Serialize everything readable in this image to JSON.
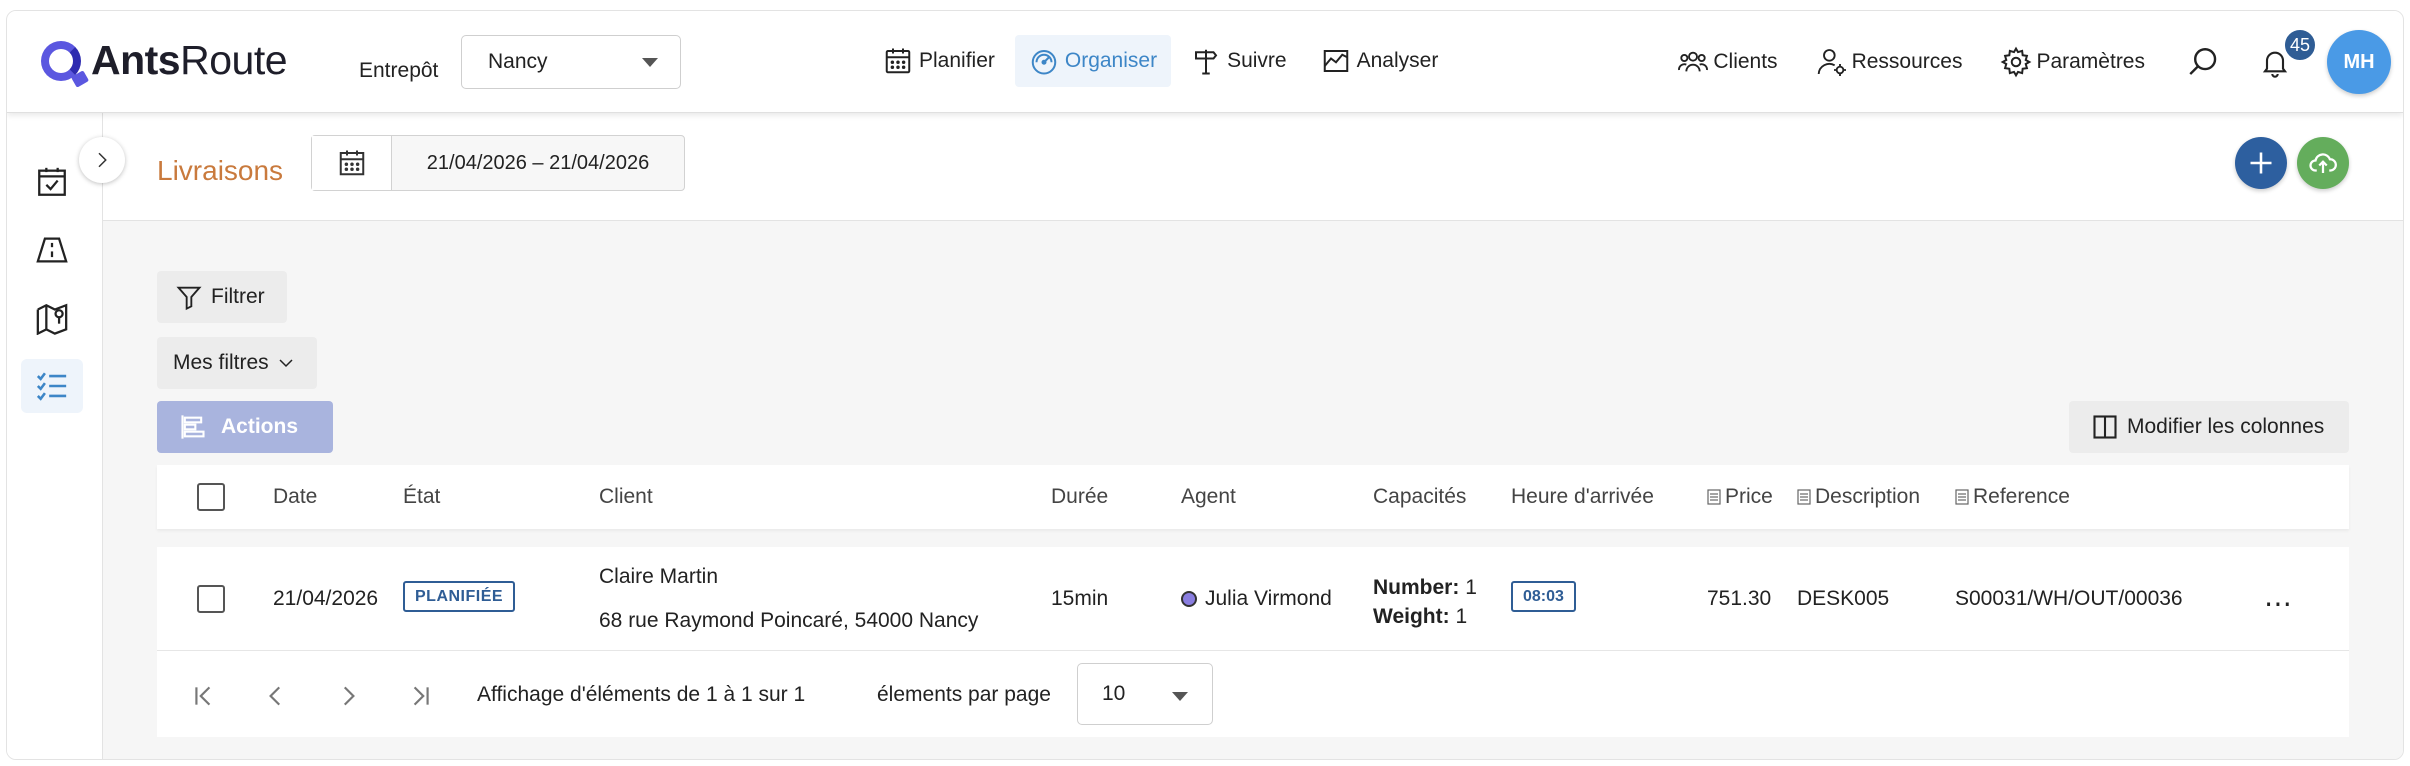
{
  "app": {
    "brand_bold": "Ants",
    "brand_regular": "Route"
  },
  "header": {
    "warehouse_label": "Entrepôt",
    "warehouse_value": "Nancy",
    "nav": [
      {
        "label": "Planifier",
        "icon": "calendar-icon"
      },
      {
        "label": "Organiser",
        "icon": "gauge-icon",
        "active": true
      },
      {
        "label": "Suivre",
        "icon": "signpost-icon"
      },
      {
        "label": "Analyser",
        "icon": "chart-icon"
      }
    ],
    "right_nav": [
      {
        "label": "Clients",
        "icon": "users-icon"
      },
      {
        "label": "Ressources",
        "icon": "user-gear-icon"
      },
      {
        "label": "Paramètres",
        "icon": "gear-icon"
      }
    ],
    "notification_count": "45",
    "avatar_initials": "MH"
  },
  "page": {
    "title": "Livraisons",
    "date_range": "21/04/2026 – 21/04/2026"
  },
  "toolbar": {
    "filter_label": "Filtrer",
    "my_filters_label": "Mes filtres",
    "actions_label": "Actions",
    "columns_label": "Modifier les colonnes"
  },
  "table": {
    "columns": {
      "date": "Date",
      "state": "État",
      "client": "Client",
      "duration": "Durée",
      "agent": "Agent",
      "capacities": "Capacités",
      "arrival": "Heure d'arrivée",
      "price": "Price",
      "description": "Description",
      "reference": "Reference"
    },
    "rows": [
      {
        "date": "21/04/2026",
        "state": "PLANIFIÉE",
        "client_name": "Claire Martin",
        "client_address": "68 rue Raymond Poincaré, 54000 Nancy",
        "duration": "15min",
        "agent": "Julia Virmond",
        "cap_number_label": "Number:",
        "cap_number": "1",
        "cap_weight_label": "Weight:",
        "cap_weight": "1",
        "arrival": "08:03",
        "price": "751.30",
        "description": "DESK005",
        "reference": "S00031/WH/OUT/00036"
      }
    ]
  },
  "pager": {
    "summary": "Affichage d'éléments de 1 à 1 sur 1",
    "per_page_label": "élements par page",
    "per_page_value": "10"
  },
  "colors": {
    "accent": "#3d86c7",
    "brand": "#5b57e0",
    "title": "#c97a3d",
    "primary_dark": "#2d5f9f",
    "success": "#64ad5c",
    "actions_disabled": "#a9b4de"
  }
}
